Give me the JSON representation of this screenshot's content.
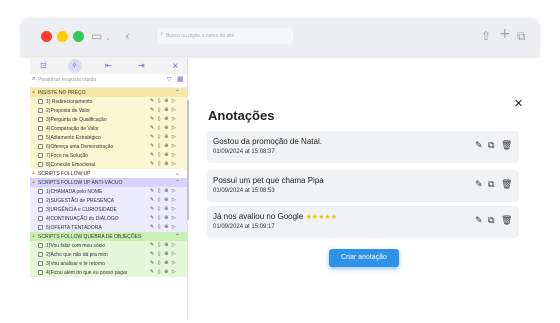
{
  "browser": {
    "address_placeholder": "Busca ou digite o nome do site"
  },
  "panel": {
    "search_placeholder": "Pesquisar resposta rápida",
    "groups": [
      {
        "title": "INSISTE NO PREÇO",
        "color": "yellow",
        "items": [
          "1) Redirecionamento",
          "2)Proposta de Valor",
          "3)Pergunta de Qualificação",
          "4)Comparação de Valor",
          "5)Adiamento Estratégico",
          "6)Ofereça uma Demonstração",
          "7)Foco na Solução",
          "8)Conexão Emocional"
        ]
      },
      {
        "title": "SCRIPTS FOLLOW UP",
        "color": "plain",
        "items": []
      },
      {
        "title": "SCRIPTS FOLLOW UP ANTI-VÁCUO",
        "color": "purple",
        "items": [
          "1)CHAMADA pelo NOME",
          "2)SUGESTÃO de PRESENÇA",
          "3)URGÊNCIA e CURIOSIDADE",
          "4)CONTINUAÇÃO do DIÁLOGO",
          "5)OFERTA TENTADORA"
        ]
      },
      {
        "title": "SCRIPTS FOLLOW QUEBRA DE OBJEÇÕES",
        "color": "green",
        "items": [
          "1)Vou falar com meu sócio",
          "2)Acho que não dá pra mim",
          "3)Vou analisar e te retorno",
          "4)Ficou além do que eu posso pagar"
        ]
      }
    ]
  },
  "modal": {
    "title": "Anotações",
    "notes": [
      {
        "text": "Gostou da promoção de Natal.",
        "date": "01/09/2024 at 15:08:37",
        "stars": ""
      },
      {
        "text": "Possui um pet que chama Pipa",
        "date": "01/09/2024 at 15:08:53",
        "stars": ""
      },
      {
        "text": "Já nos avaliou no Google ",
        "date": "01/09/2024 at 15:09:17",
        "stars": "★★★★★"
      }
    ],
    "create_button": "Criar anotação"
  },
  "colors": {
    "accent": "#2e93e8",
    "stars": "#f2c200"
  }
}
